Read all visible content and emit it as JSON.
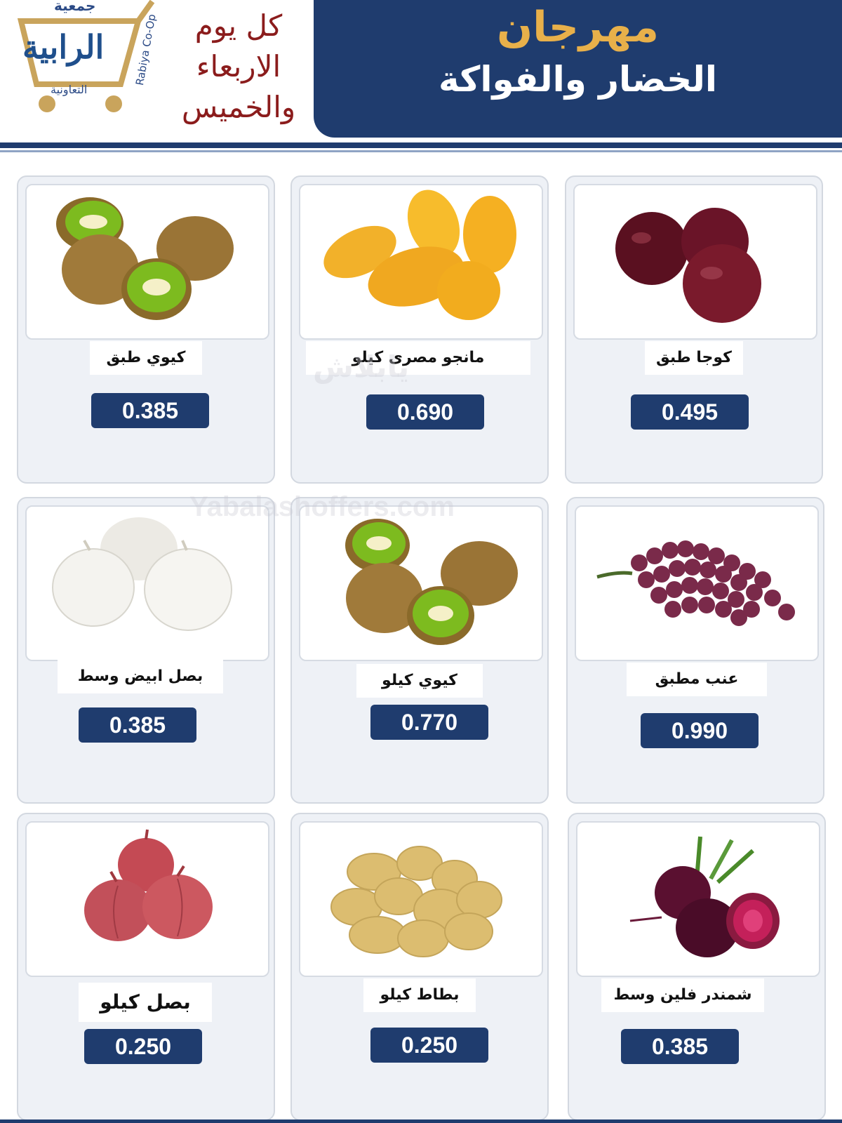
{
  "header": {
    "title": "مهرجان",
    "subtitle": "الخضار والفواكة",
    "days_line1": "كل يوم",
    "days_line2": "الاربعاء",
    "days_line3": "والخميس"
  },
  "logo": {
    "top_text": "جمعية",
    "name": "الرابية",
    "bottom_text": "التعاونية",
    "latin": "Rabiya Co-Op"
  },
  "watermarks": {
    "site": "Yabalashoffers.com",
    "arabic": "يابلاش"
  },
  "colors": {
    "navy": "#1f3c6e",
    "gold": "#e8b04a",
    "maroon": "#8b1c1c"
  },
  "products": [
    {
      "name": "كوجا طبق",
      "price": "0.495",
      "icon": "plums-icon"
    },
    {
      "name": "مانجو مصرى كيلو",
      "price": "0.690",
      "icon": "mango-icon"
    },
    {
      "name": "كيوي طبق",
      "price": "0.385",
      "icon": "kiwi-icon"
    },
    {
      "name": "عنب مطبق",
      "price": "0.990",
      "icon": "grapes-icon"
    },
    {
      "name": "كيوي كيلو",
      "price": "0.770",
      "icon": "kiwi-icon"
    },
    {
      "name": "بصل ابيض وسط",
      "price": "0.385",
      "icon": "white-onion-icon"
    },
    {
      "name": "شمندر فلين وسط",
      "price": "0.385",
      "icon": "beetroot-icon"
    },
    {
      "name": "بطاط كيلو",
      "price": "0.250",
      "icon": "potato-icon"
    },
    {
      "name": "بصل كيلو",
      "price": "0.250",
      "icon": "red-onion-icon"
    }
  ]
}
